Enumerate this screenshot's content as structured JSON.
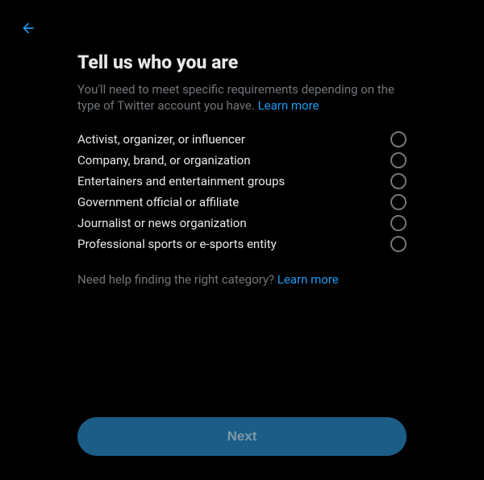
{
  "header": {
    "title": "Tell us who you are",
    "description": "You'll need to meet specific requirements depending on the type of Twitter account you have. ",
    "learn_more": "Learn more"
  },
  "options": [
    {
      "label": "Activist, organizer, or influencer"
    },
    {
      "label": "Company, brand, or organization"
    },
    {
      "label": "Entertainers and entertainment groups"
    },
    {
      "label": "Government official or affiliate"
    },
    {
      "label": "Journalist or news organization"
    },
    {
      "label": "Professional sports or e-sports entity"
    }
  ],
  "help": {
    "text": "Need help finding the right category? ",
    "learn_more": "Learn more"
  },
  "buttons": {
    "next": "Next"
  }
}
